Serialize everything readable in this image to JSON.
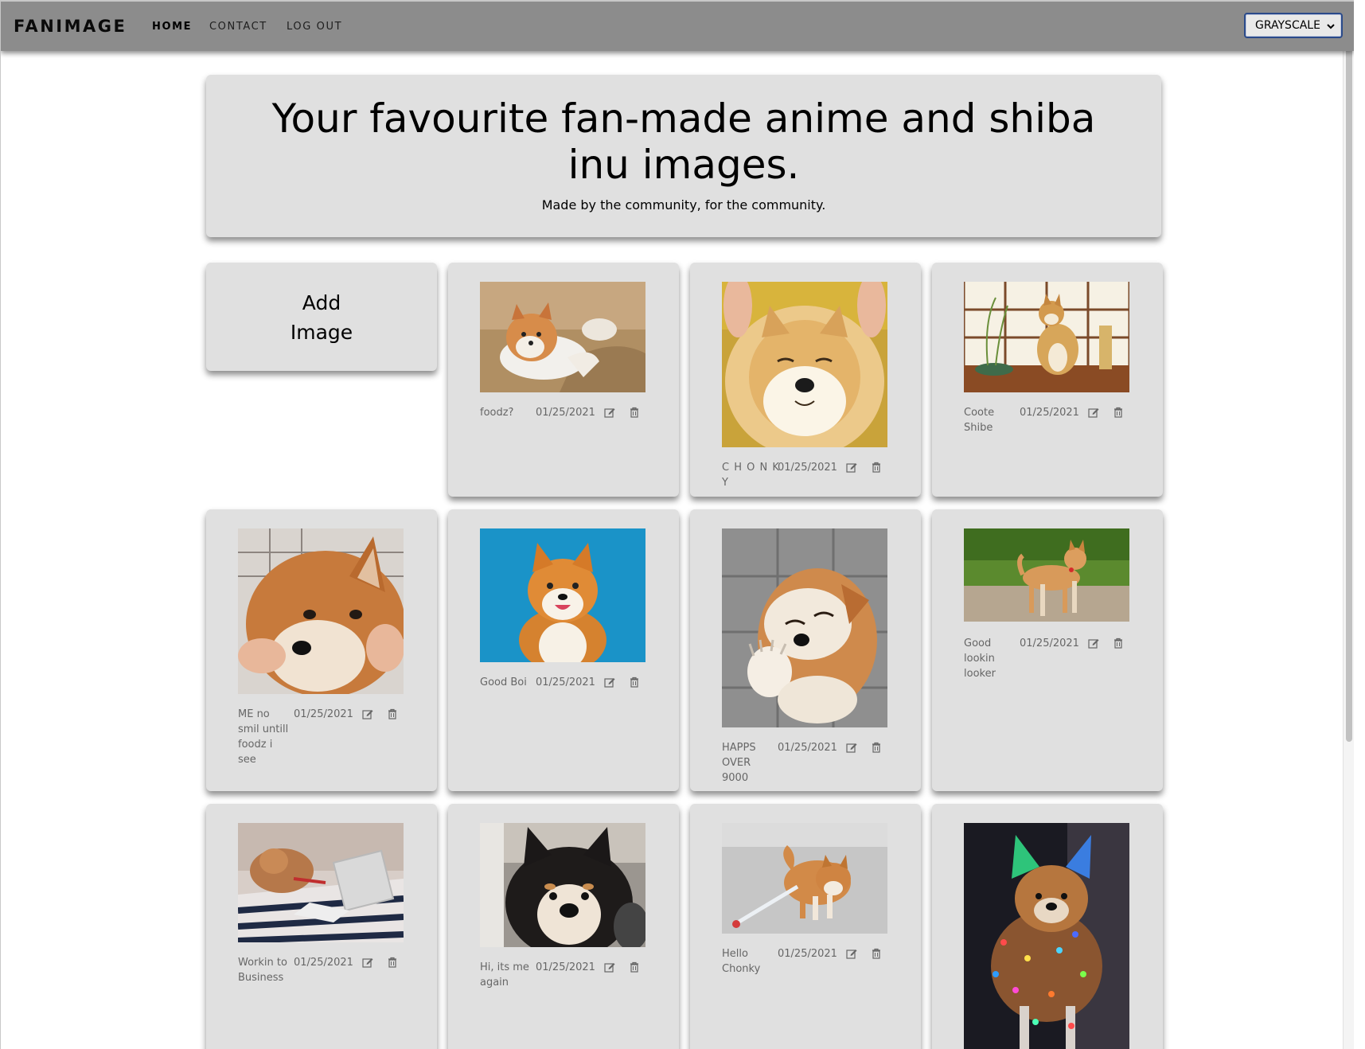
{
  "navbar": {
    "brand": "FANIMAGE",
    "links": [
      "HOME",
      "CONTACT",
      "LOG OUT"
    ],
    "theme_select": {
      "value": "GRAYSCALE"
    }
  },
  "hero": {
    "title": "Your favourite fan-made anime and shiba inu images.",
    "subtitle": "Made by the community, for the community."
  },
  "add_card": {
    "line1": "Add",
    "line2": "Image"
  },
  "cards": [
    {
      "title": "foodz?",
      "date": "01/25/2021",
      "image": "shiba on couch"
    },
    {
      "title": "C H O N K Y",
      "date": "01/25/2021",
      "image": "shiba face squeezed"
    },
    {
      "title": "Coote Shibe",
      "date": "01/25/2021",
      "image": "shiba by window"
    },
    {
      "title": "ME no smil untill foodz i see",
      "date": "01/25/2021",
      "image": "shiba cheeks held"
    },
    {
      "title": "Good Boi",
      "date": "01/25/2021",
      "image": "smiling shiba blue background"
    },
    {
      "title": "HAPPS OVER 9000",
      "date": "01/25/2021",
      "image": "happy shiba waving paw"
    },
    {
      "title": "Good lookin looker",
      "date": "01/25/2021",
      "image": "shiba standing on path"
    },
    {
      "title": "Workin to Business",
      "date": "01/25/2021",
      "image": "shiba with laptop"
    },
    {
      "title": "Hi, its me again",
      "date": "01/25/2021",
      "image": "black and tan shiba"
    },
    {
      "title": "Hello Chonky",
      "date": "01/25/2021",
      "image": "shiba on leash"
    },
    {
      "title": "",
      "date": "",
      "image": "shiba with fairy lights"
    }
  ],
  "icons": {
    "edit": "edit-icon",
    "delete": "trash-icon",
    "select_arrow": "chevron-down-icon"
  }
}
